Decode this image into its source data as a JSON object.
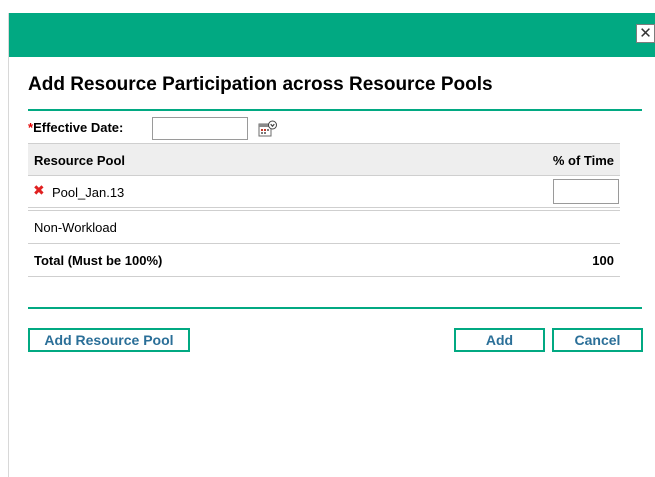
{
  "dialog": {
    "close_symbol": "✕",
    "title": "Add Resource Participation across Resource Pools",
    "accent_color": "#01a982"
  },
  "effective_date": {
    "required_marker": "*",
    "label": "Effective Date:",
    "value": ""
  },
  "icons": {
    "calendar": "calendar-icon",
    "delete": "delete-x-icon",
    "close": "close-icon"
  },
  "table": {
    "headers": {
      "pool": "Resource Pool",
      "pct": "% of Time"
    },
    "rows": [
      {
        "delete_symbol": "✖",
        "pool": "Pool_Jan.13",
        "pct_value": ""
      }
    ],
    "non_workload_label": "Non-Workload",
    "total_label": "Total (Must be 100%)",
    "total_value": "100"
  },
  "buttons": {
    "add_pool": "Add Resource Pool",
    "add": "Add",
    "cancel": "Cancel"
  }
}
